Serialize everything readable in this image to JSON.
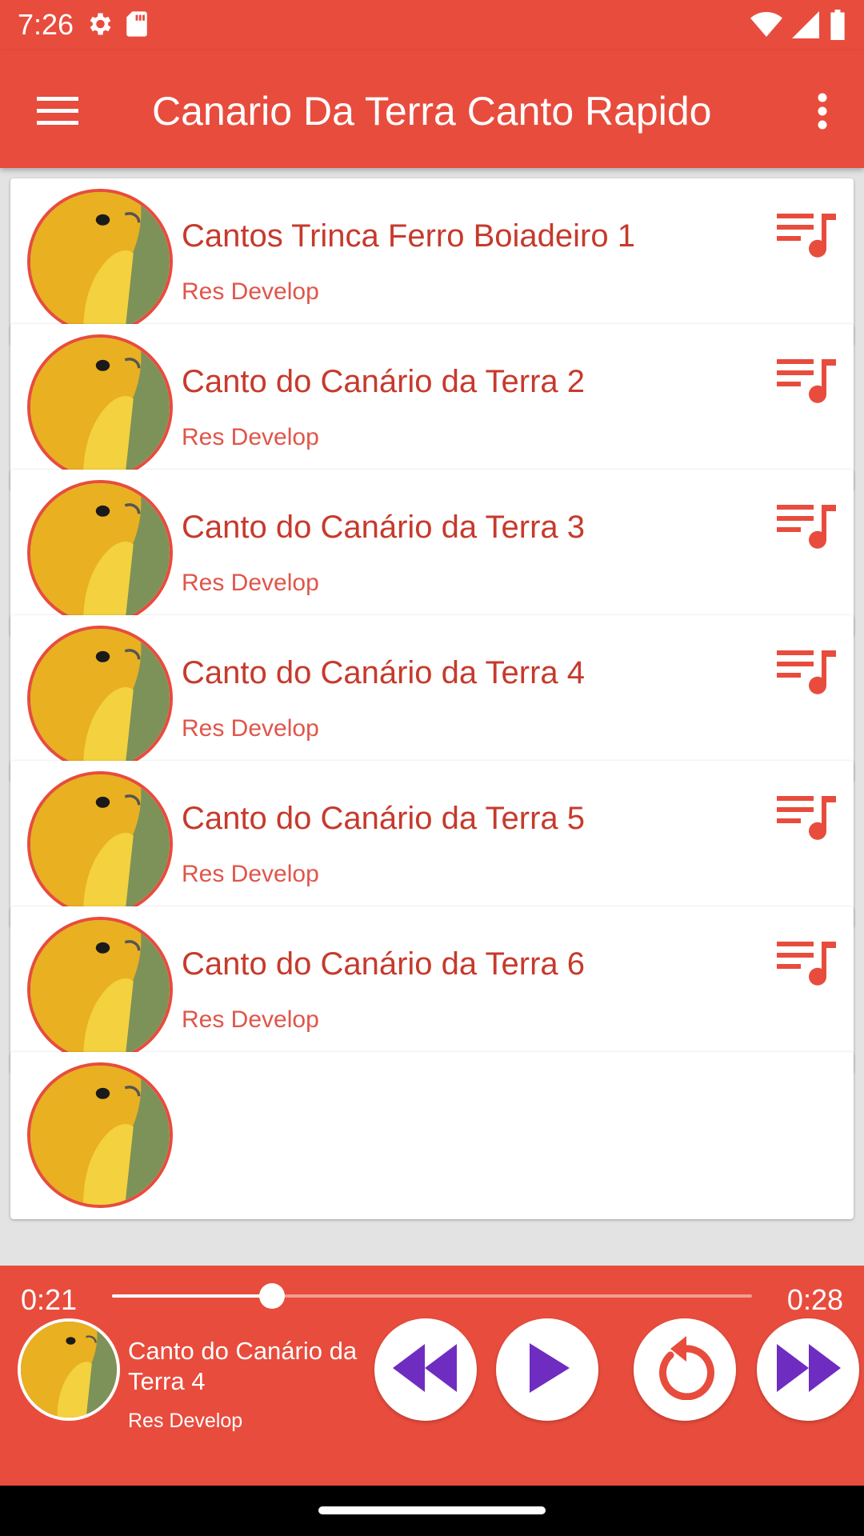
{
  "status_bar": {
    "time": "7:26",
    "left_icons": [
      "settings-icon",
      "sd-card-icon"
    ],
    "right_icons": [
      "wifi-icon",
      "signal-icon",
      "battery-icon"
    ]
  },
  "app_bar": {
    "title": "Canario Da Terra Canto Rapido",
    "menu_icon": "hamburger-menu-icon",
    "overflow_icon": "more-vert-icon"
  },
  "colors": {
    "accent": "#e84c3d",
    "title_text": "#c63a2c",
    "controls": "#6f2cc0"
  },
  "tracks": [
    {
      "title": "Cantos Trinca Ferro Boiadeiro 1",
      "artist": "Res Develop"
    },
    {
      "title": "Canto do Canário da Terra 2",
      "artist": "Res Develop"
    },
    {
      "title": "Canto do Canário da Terra 3",
      "artist": "Res Develop"
    },
    {
      "title": "Canto do Canário da Terra 4",
      "artist": "Res Develop"
    },
    {
      "title": "Canto do Canário da Terra 5",
      "artist": "Res Develop"
    },
    {
      "title": "Canto do Canário da Terra 6",
      "artist": "Res Develop"
    }
  ],
  "player": {
    "current_time": "0:21",
    "total_time": "0:28",
    "progress_fraction": 0.25,
    "title": "Canto do Canário da Terra 4",
    "artist": "Res Develop",
    "controls": [
      "rewind-icon",
      "play-icon",
      "replay-icon",
      "fast-forward-icon"
    ]
  }
}
